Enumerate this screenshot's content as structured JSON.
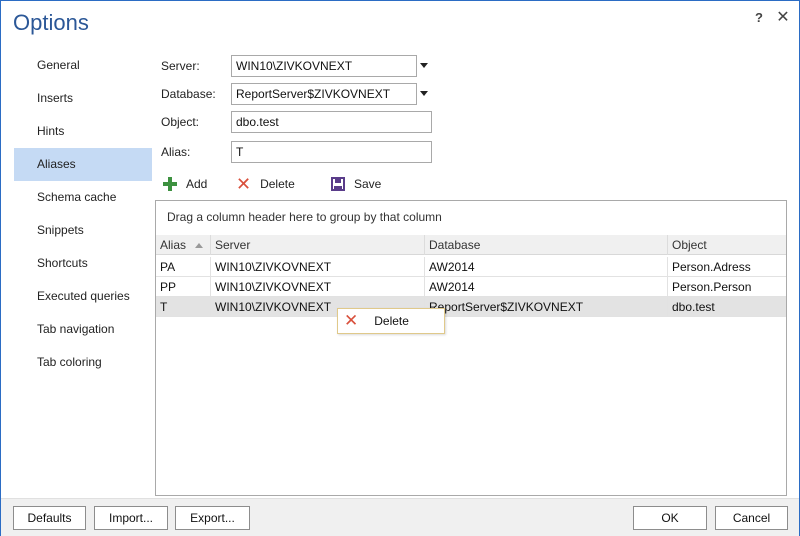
{
  "window": {
    "title": "Options",
    "help_glyph": "?",
    "close_glyph": "✕",
    "accent": "#2b5797",
    "border": "#2b6cc4"
  },
  "sidebar": {
    "active_color": "#c5daf4",
    "items": [
      {
        "label": "General"
      },
      {
        "label": "Inserts"
      },
      {
        "label": "Hints"
      },
      {
        "label": "Aliases"
      },
      {
        "label": "Schema cache"
      },
      {
        "label": "Snippets"
      },
      {
        "label": "Shortcuts"
      },
      {
        "label": "Executed queries"
      },
      {
        "label": "Tab navigation"
      },
      {
        "label": "Tab coloring"
      }
    ]
  },
  "form": {
    "server_label": "Server:",
    "server_value": "WIN10\\ZIVKOVNEXT",
    "database_label": "Database:",
    "database_value": "ReportServer$ZIVKOVNEXT",
    "object_label": "Object:",
    "object_value": "dbo.test",
    "alias_label": "Alias:",
    "alias_value": "T"
  },
  "toolbar": {
    "add_label": "Add",
    "delete_label": "Delete",
    "save_label": "Save",
    "add_icon": "plus-icon",
    "delete_icon": "x-icon",
    "save_icon": "floppy-icon"
  },
  "grid": {
    "group_hint": "Drag a column header here to group by that column",
    "columns": [
      "Alias",
      "Server",
      "Database",
      "Object"
    ],
    "rows": [
      [
        "PA",
        "WIN10\\ZIVKOVNEXT",
        "AW2014",
        "Person.Adress"
      ],
      [
        "PP",
        "WIN10\\ZIVKOVNEXT",
        "AW2014",
        "Person.Person"
      ],
      [
        "T",
        "WIN10\\ZIVKOVNEXT",
        "ReportServer$ZIVKOVNEXT",
        "dbo.test"
      ]
    ],
    "selected_row": 3
  },
  "context_menu": {
    "delete_label": "Delete"
  },
  "footer": {
    "defaults_label": "Defaults",
    "import_label": "Import...",
    "export_label": "Export...",
    "ok_label": "OK",
    "cancel_label": "Cancel"
  }
}
